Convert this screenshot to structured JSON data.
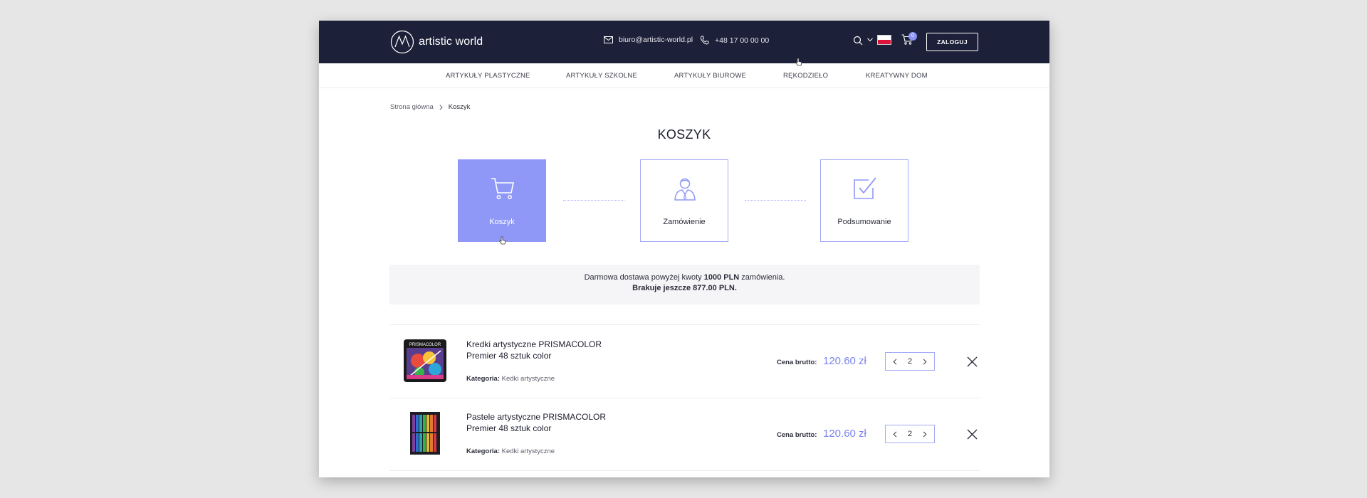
{
  "header": {
    "logo_text": "artistic world",
    "email": "biuro@artistic-world.pl",
    "phone": "+48 17 00 00 00",
    "cart_count": "0",
    "login_label": "ZALOGUJ",
    "accent_color": "#8f98f7",
    "bg_color": "#1c2038"
  },
  "nav": {
    "items": [
      "ARTYKUŁY PLASTYCZNE",
      "ARTYKUŁY SZKOLNE",
      "ARTYKUŁY BIUROWE",
      "RĘKODZIEŁO",
      "KREATYWNY DOM"
    ]
  },
  "breadcrumb": {
    "home": "Strona główna",
    "current": "Koszyk"
  },
  "page_title": "KOSZYK",
  "steps": [
    {
      "label": "Koszyk",
      "icon": "cart-icon",
      "active": true
    },
    {
      "label": "Zamówienie",
      "icon": "person-icon",
      "active": false
    },
    {
      "label": "Podsumowanie",
      "icon": "checkbox-icon",
      "active": false
    }
  ],
  "info": {
    "prefix": "Darmowa dostawa powyżej kwoty",
    "amount": "1000 PLN",
    "suffix": "zamówienia.",
    "remaining": "Brakuje jeszcze 877.00 PLN."
  },
  "products": [
    {
      "name_line1": "Kredki artystyczne  PRISMACOLOR",
      "name_line2": "Premier 48 sztuk color",
      "category_label": "Kategoria:",
      "category": "Kedki artystyczne",
      "price_label": "Cena brutto:",
      "price": "120.60 zł",
      "quantity": "2"
    },
    {
      "name_line1": "Pastele artystyczne PRISMACOLOR",
      "name_line2": "Premier 48 sztuk color",
      "category_label": "Kategoria:",
      "category": "Kedki artystyczne",
      "price_label": "Cena brutto:",
      "price": "120.60 zł",
      "quantity": "2"
    }
  ],
  "thumb_label": "PRISMACOLOR"
}
